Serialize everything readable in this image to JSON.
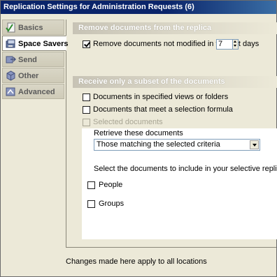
{
  "window": {
    "title": "Replication Settings for Administration Requests (6)"
  },
  "nav": {
    "items": [
      {
        "label": "Basics",
        "icon": "checkmark-page-icon",
        "active": false
      },
      {
        "label": "Space Savers",
        "icon": "disk-icon",
        "active": true
      },
      {
        "label": "Send",
        "icon": "send-arrow-icon",
        "active": false
      },
      {
        "label": "Other",
        "icon": "cube-icon",
        "active": false
      },
      {
        "label": "Advanced",
        "icon": "advanced-icon",
        "active": false
      }
    ]
  },
  "remove_section": {
    "header": "Remove documents from the replica",
    "checkbox_label": "Remove documents not modified in the last",
    "checked": true,
    "days_value": "7",
    "days_label": "days"
  },
  "subset_section": {
    "header": "Receive only a subset of the documents",
    "options": [
      {
        "label": "Documents in specified views or folders",
        "checked": false,
        "disabled": false
      },
      {
        "label": "Documents that meet a selection formula",
        "checked": false,
        "disabled": false
      },
      {
        "label": "Selected documents",
        "checked": false,
        "disabled": true
      }
    ],
    "retrieve_label": "Retrieve these documents",
    "retrieve_selected": "Those matching the selected criteria",
    "select_prompt": "Select the documents to include in your selective replica:",
    "doc_types": [
      {
        "label": "People",
        "checked": false
      },
      {
        "label": "Groups",
        "checked": false
      }
    ]
  },
  "footer": {
    "note": "Changes made here apply to all locations"
  },
  "colors": {
    "titlebar": "#0a246a",
    "panel_bg": "#ece9d8",
    "section_header": "#c7c3b5",
    "disabled_text": "#a8a594"
  }
}
